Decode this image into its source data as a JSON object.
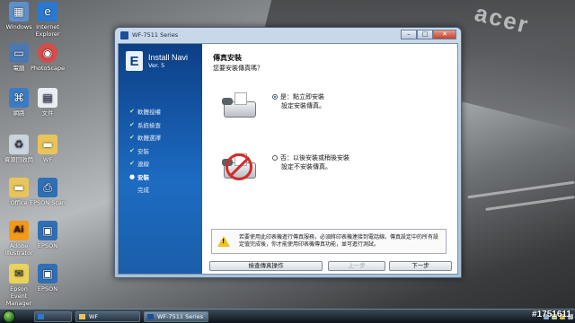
{
  "desktop": {
    "icons": [
      {
        "label": "Windows",
        "glyph": "computer-icon",
        "color": "#5d8fc9"
      },
      {
        "label": "Internet Explorer",
        "glyph": "internet-explorer-icon",
        "color": "#2a78d0"
      },
      {
        "label": "電腦",
        "glyph": "computer-icon",
        "color": "#4a78b0"
      },
      {
        "label": "PhotoScape",
        "glyph": "photoscape-icon",
        "color": "#d94a4a"
      },
      {
        "label": "網路",
        "glyph": "network-icon",
        "color": "#3a7cc4"
      },
      {
        "label": "文件",
        "glyph": "document-icon",
        "color": "#e9eef3"
      },
      {
        "label": "資源回收筒",
        "glyph": "recycle-bin-icon",
        "color": "#c9d4df"
      },
      {
        "label": "WF",
        "glyph": "folder-icon",
        "color": "#e8c45a"
      },
      {
        "label": "Office",
        "glyph": "folder-icon",
        "color": "#e8c45a"
      },
      {
        "label": "EPSON Scan",
        "glyph": "scanner-icon",
        "color": "#2f6fb3"
      },
      {
        "label": "Adobe Illustrator",
        "glyph": "illustrator-icon",
        "color": "#f19a1a"
      },
      {
        "label": "EPSON",
        "glyph": "epson-icon",
        "color": "#2f6fb3"
      },
      {
        "label": "Epson Event Manager",
        "glyph": "event-manager-icon",
        "color": "#e9d35a"
      },
      {
        "label": "EPSON",
        "glyph": "epson-icon",
        "color": "#2f6fb3"
      }
    ],
    "brand_logo": "acer",
    "watermark": "#1751611"
  },
  "window": {
    "title": "WF-7511 Series",
    "controls": {
      "minimize": "–",
      "maximize": "□",
      "close": "✕"
    }
  },
  "rail": {
    "logo_letter": "E",
    "title": "Install Navi",
    "version": "Ver. 5",
    "steps": [
      {
        "label": "軟體授權",
        "state": "done"
      },
      {
        "label": "系統檢查",
        "state": "done"
      },
      {
        "label": "軟體選擇",
        "state": "done"
      },
      {
        "label": "安裝",
        "state": "done"
      },
      {
        "label": "連線",
        "state": "done"
      },
      {
        "label": "安裝",
        "state": "current"
      },
      {
        "label": "完成",
        "state": "pending"
      }
    ],
    "done_mark": "✔",
    "current_mark": "●"
  },
  "content": {
    "heading": "傳真安裝",
    "question": "您要安裝傳真嗎？",
    "options": [
      {
        "title": "是：點立即安裝",
        "desc": "設定安裝傳真。",
        "selected": true
      },
      {
        "title": "否：以後安裝或稍後安裝",
        "desc": "設定不安裝傳真。",
        "selected": false
      }
    ],
    "notice": "若要使用此印表機進行傳真服務，必須將印表機連接到電話線。傳真設定中的所有設定值完成後，你才能使用印表機傳真功能，並可進行測試。"
  },
  "buttons": {
    "manual": "檢查傳真操作",
    "back": "上一步",
    "next": "下一步"
  },
  "taskbar": {
    "items": [
      {
        "label": "",
        "icon": "ie-icon"
      },
      {
        "label": "WF",
        "icon": "folder-icon"
      },
      {
        "label": "WF-7511 Series",
        "icon": "installer-icon",
        "active": true
      }
    ]
  }
}
